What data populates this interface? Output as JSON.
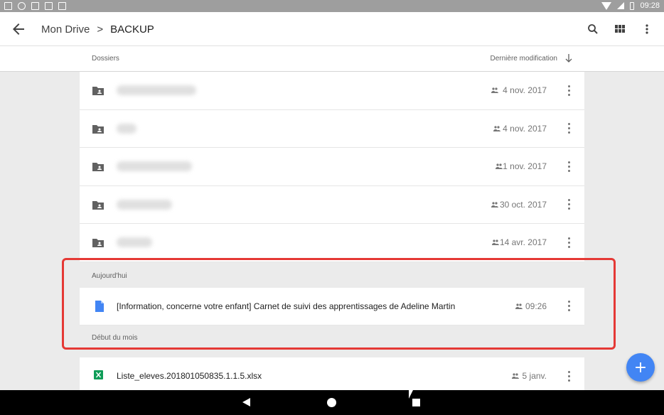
{
  "status_bar": {
    "time": "09:28"
  },
  "app_bar": {
    "crumbs": [
      "Mon Drive",
      "BACKUP"
    ],
    "separator": ">"
  },
  "column_header": {
    "folders_label": "Dossiers",
    "modified_label": "Dernière modification"
  },
  "folders": [
    {
      "date": "4 nov. 2017"
    },
    {
      "date": "4 nov. 2017"
    },
    {
      "date": "1 nov. 2017"
    },
    {
      "date": "30 oct. 2017"
    },
    {
      "date": "14 avr. 2017"
    }
  ],
  "sections": {
    "today": "Aujourd'hui",
    "month_start": "Début du mois"
  },
  "today_files": [
    {
      "name": "[Information, concerne votre enfant] Carnet de suivi des apprentissages de Adeline Martin",
      "date": "09:26",
      "icon": "doc-icon"
    }
  ],
  "month_files": [
    {
      "name": "Liste_eleves.201801050835.1.1.5.xlsx",
      "date": "5 janv.",
      "icon": "sheet-icon"
    }
  ],
  "fab": {
    "label": "+"
  },
  "colors": {
    "accent": "#4285f4",
    "highlight": "#e53935",
    "doc_blue": "#4285f4",
    "sheet_green": "#0f9d58"
  }
}
